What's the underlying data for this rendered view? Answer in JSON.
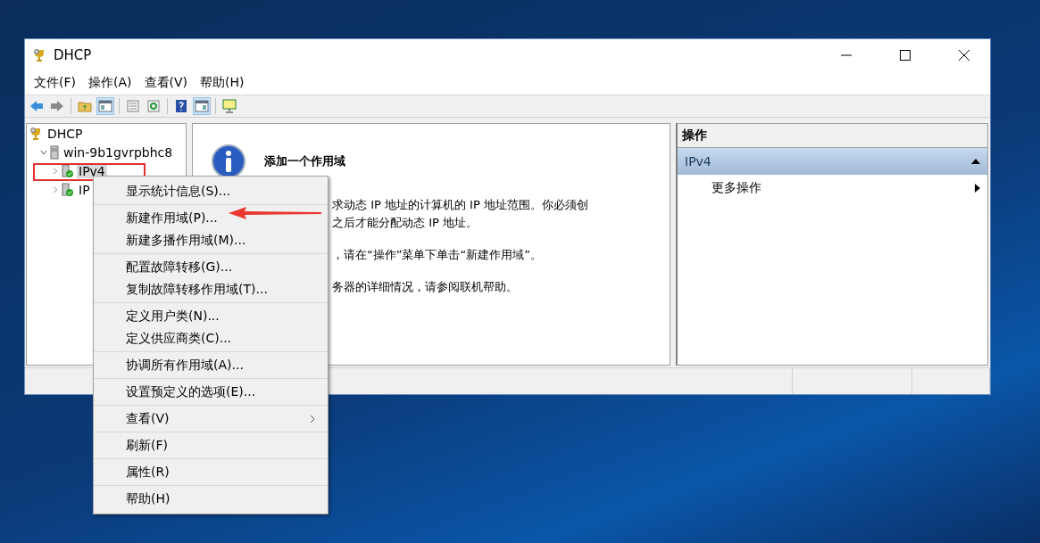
{
  "window": {
    "title": "DHCP"
  },
  "menu_bar": [
    "文件(F)",
    "操作(A)",
    "查看(V)",
    "帮助(H)"
  ],
  "toolbar": [
    {
      "kind": "back",
      "selected": false
    },
    {
      "kind": "forward",
      "selected": false
    },
    {
      "kind": "sep"
    },
    {
      "kind": "folder-up",
      "selected": false
    },
    {
      "kind": "pane",
      "selected": true
    },
    {
      "kind": "sep"
    },
    {
      "kind": "list",
      "selected": false
    },
    {
      "kind": "refresh",
      "selected": false
    },
    {
      "kind": "sep"
    },
    {
      "kind": "help",
      "selected": false
    },
    {
      "kind": "pane-right",
      "selected": true
    },
    {
      "kind": "sep"
    },
    {
      "kind": "monitor",
      "selected": false
    }
  ],
  "tree": [
    {
      "label": "DHCP",
      "kind": "root",
      "children": [
        {
          "label": "win-9b1gvrpbhc8",
          "kind": "server",
          "expanded": true,
          "children": [
            {
              "label": "IPv4",
              "kind": "scope",
              "expanded": false,
              "selected": true
            },
            {
              "label": "IP",
              "kind": "scope",
              "expanded": false,
              "selected": false
            }
          ]
        }
      ]
    }
  ],
  "center": {
    "heading": "添加一个作用域",
    "paragraphs": [
      [
        "求动态 IP 地址的计算机的 IP 地址范围。你必须创",
        "之后才能分配动态 IP 地址。"
      ],
      [
        "，请在“操作”菜单下单击“新建作用域”。"
      ],
      [
        "务器的详细情况，请参阅联机帮助。"
      ]
    ]
  },
  "actions": {
    "header": "操作",
    "groups": [
      {
        "title": "IPv4",
        "expanded": true,
        "items": [
          {
            "label": "更多操作",
            "submenu": true
          }
        ]
      }
    ]
  },
  "context_menu": [
    [
      {
        "label": "显示统计信息(S)...",
        "submenu": false
      }
    ],
    [
      {
        "label": "新建作用域(P)...",
        "submenu": false
      },
      {
        "label": "新建多播作用域(M)...",
        "submenu": false
      }
    ],
    [
      {
        "label": "配置故障转移(G)...",
        "submenu": false
      },
      {
        "label": "复制故障转移作用域(T)...",
        "submenu": false
      }
    ],
    [
      {
        "label": "定义用户类(N)...",
        "submenu": false
      },
      {
        "label": "定义供应商类(C)...",
        "submenu": false
      }
    ],
    [
      {
        "label": "协调所有作用域(A)...",
        "submenu": false
      }
    ],
    [
      {
        "label": "设置预定义的选项(E)...",
        "submenu": false
      }
    ],
    [
      {
        "label": "查看(V)",
        "submenu": true
      }
    ],
    [
      {
        "label": "刷新(F)",
        "submenu": false
      }
    ],
    [
      {
        "label": "属性(R)",
        "submenu": false
      }
    ],
    [
      {
        "label": "帮助(H)",
        "submenu": false
      }
    ]
  ]
}
